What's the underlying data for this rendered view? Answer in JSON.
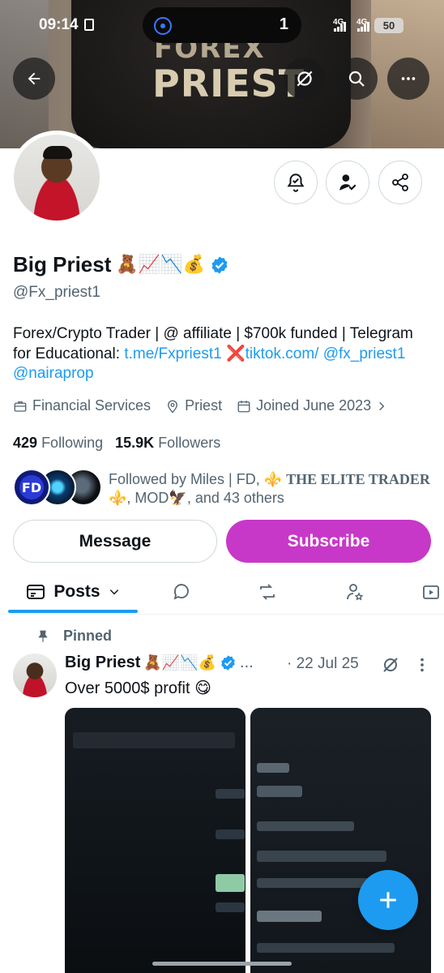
{
  "status_bar": {
    "time": "09:14",
    "notification_count": "1",
    "network_1": "4G",
    "network_2": "4G",
    "battery": "50"
  },
  "banner": {
    "jacket_text_line1": "FOREX",
    "jacket_text_line2": "PRIEST"
  },
  "profile": {
    "display_name": "Big Priest",
    "name_emojis": "🧸📈📉💰",
    "handle": "@Fx_priest1",
    "bio_part1": "Forex/Crypto Trader | @ affiliate | $700k funded | Telegram for Educational: ",
    "bio_link1": "t.me/Fxpriest1",
    "bio_cross": "❌",
    "bio_link2": "tiktok.com/",
    "bio_link3": "@fx_priest1",
    "bio_link4": "@nairaprop",
    "category": "Financial Services",
    "location": "Priest",
    "joined": "Joined June 2023",
    "following_count": "429",
    "following_label": "Following",
    "followers_count": "15.9K",
    "followers_label": "Followers",
    "followed_by_text1": "Followed by Miles | FD, ⚜️ ",
    "followed_by_bold": "THE ELITE TRADER",
    "followed_by_text2": "⚜️, MOD🦅, and 43 others",
    "fd_avatar_text": "FD"
  },
  "buttons": {
    "message": "Message",
    "subscribe": "Subscribe"
  },
  "tabs": {
    "posts": "Posts"
  },
  "tweet": {
    "pinned_label": "Pinned",
    "author": "Big Priest",
    "author_emojis": "🧸📈📉💰",
    "ellipsis": "...",
    "date": "· 22 Jul 25",
    "text": "Over 5000$ profit 😋"
  },
  "colors": {
    "accent": "#1d9bf0",
    "subscribe": "#c838c8",
    "secondary_text": "#536471"
  }
}
